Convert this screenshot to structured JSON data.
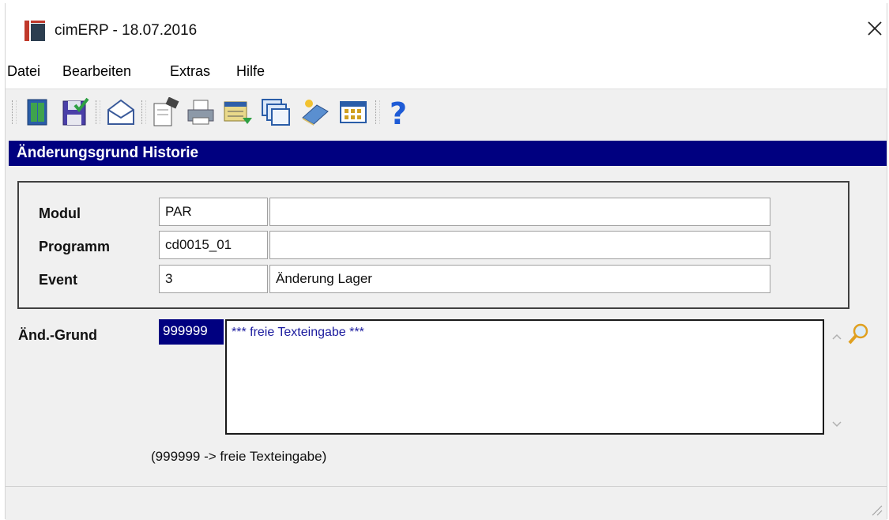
{
  "window": {
    "title": "cimERP - 18.07.2016",
    "icons": {
      "app": "cimerp-app-icon",
      "close": "close-icon"
    }
  },
  "menu": [
    "Datei",
    "Bearbeiten",
    "Extras",
    "Hilfe"
  ],
  "toolbar": {
    "buttons": [
      "exit-door-icon",
      "save-check-icon",
      "mail-envelope-icon",
      "edit-document-icon",
      "print-icon",
      "export-list-icon",
      "windows-stack-icon",
      "book-help-icon",
      "calendar-grid-icon",
      "help-question-icon"
    ]
  },
  "panel": {
    "title": "Änderungsgrund Historie",
    "header_color": "#000080"
  },
  "fields": {
    "modul": {
      "label": "Modul",
      "code": "PAR",
      "description": ""
    },
    "programm": {
      "label": "Programm",
      "code": "cd0015_01",
      "description": ""
    },
    "event": {
      "label": "Event",
      "code": "3",
      "description": "Änderung Lager"
    }
  },
  "reason": {
    "label": "Änd.-Grund",
    "code": "999999",
    "text": "*** freie Texteingabe ***",
    "hint": "(999999 -> freie Texteingabe)",
    "lookup_icon": "magnifier-icon",
    "text_color": "#1b1b9e"
  }
}
